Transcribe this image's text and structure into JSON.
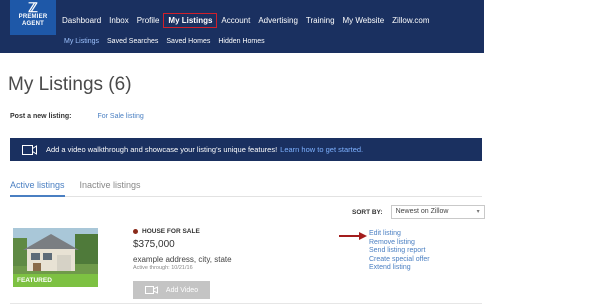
{
  "brand": {
    "logo_line1": "PREMIER",
    "logo_line2": "AGENT",
    "color": "#1a3060"
  },
  "nav": {
    "items": [
      {
        "label": "Dashboard"
      },
      {
        "label": "Inbox"
      },
      {
        "label": "Profile"
      },
      {
        "label": "My Listings"
      },
      {
        "label": "Account"
      },
      {
        "label": "Advertising"
      },
      {
        "label": "Training"
      },
      {
        "label": "My Website"
      },
      {
        "label": "Zillow.com"
      }
    ],
    "active_index": 3
  },
  "subnav": {
    "items": [
      {
        "label": "My Listings"
      },
      {
        "label": "Saved Searches"
      },
      {
        "label": "Saved Homes"
      },
      {
        "label": "Hidden Homes"
      }
    ]
  },
  "page": {
    "title": "My Listings (6)",
    "post_label": "Post a new listing:",
    "post_link": "For Sale listing"
  },
  "banner": {
    "text": "Add a video walkthrough and showcase your listing's unique features!",
    "link": "Learn how to get started."
  },
  "tabs": [
    {
      "label": "Active listings"
    },
    {
      "label": "Inactive listings"
    }
  ],
  "sort": {
    "label": "SORT BY:",
    "value": "Newest on Zillow"
  },
  "listing": {
    "badge": "FEATURED",
    "type": "HOUSE FOR SALE",
    "price": "$375,000",
    "address": "example address, city, state",
    "active_through": "Active through: 10/21/16",
    "add_video": "Add Video",
    "actions": [
      {
        "label": "Edit listing"
      },
      {
        "label": "Remove listing"
      },
      {
        "label": "Send listing report"
      },
      {
        "label": "Create special offer"
      },
      {
        "label": "Extend listing"
      }
    ]
  }
}
